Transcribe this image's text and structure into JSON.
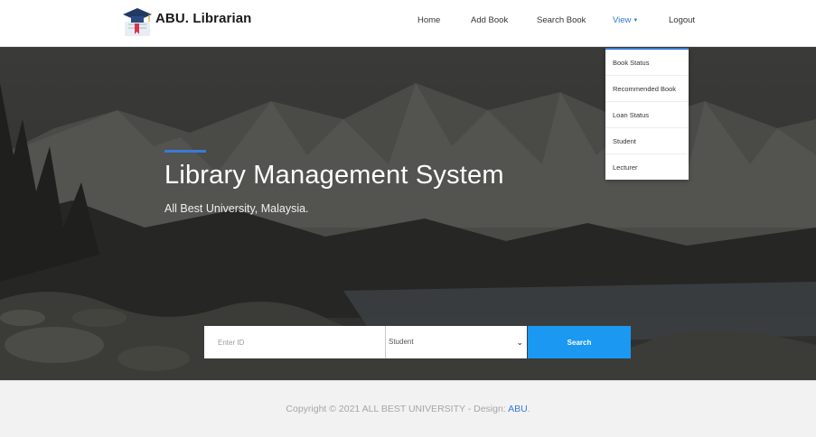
{
  "brand": {
    "name": "ABU. Librarian",
    "logo_icon": "graduation-cap-book-icon"
  },
  "nav": {
    "home": "Home",
    "add_book": "Add Book",
    "search_book": "Search Book",
    "view": "View",
    "view_caret": "▼",
    "logout": "Logout"
  },
  "dropdown": {
    "items": [
      "Book Status",
      "Recommended Book",
      "Loan Status",
      "Student",
      "Lecturer"
    ]
  },
  "hero": {
    "title": "Library Management System",
    "subtitle": "All Best University, Malaysia."
  },
  "search": {
    "id_placeholder": "Enter ID",
    "role_selected": "Student",
    "button_label": "Search"
  },
  "footer": {
    "copyright": "Copyright © 2021 ALL BEST UNIVERSITY - Design: ",
    "link": "ABU",
    "suffix": "."
  },
  "colors": {
    "accent": "#3a7bd5",
    "button": "#1a98f2",
    "nav_active": "#2f7bd1",
    "hero_overlay": "#2b2b29"
  }
}
